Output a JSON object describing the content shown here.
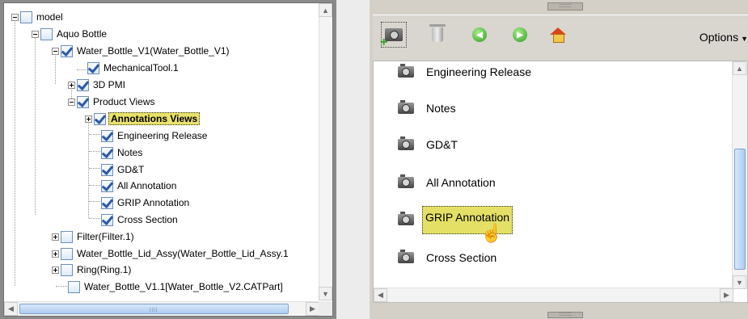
{
  "tree": {
    "nodes": [
      {
        "label": "model"
      },
      {
        "label": "Aquo Bottle"
      },
      {
        "label": "Water_Bottle_V1(Water_Bottle_V1)"
      },
      {
        "label": "MechanicalTool.1"
      },
      {
        "label": "3D PMI"
      },
      {
        "label": "Product Views"
      },
      {
        "label": "Annotations Views"
      },
      {
        "label": "Engineering Release"
      },
      {
        "label": "Notes"
      },
      {
        "label": "GD&T"
      },
      {
        "label": "All Annotation"
      },
      {
        "label": "GRIP Annotation"
      },
      {
        "label": "Cross Section"
      },
      {
        "label": "Filter(Filter.1)"
      },
      {
        "label": "Water_Bottle_Lid_Assy(Water_Bottle_Lid_Assy.1"
      },
      {
        "label": "Ring(Ring.1)"
      },
      {
        "label": "Water_Bottle_V1.1[Water_Bottle_V2.CATPart]"
      }
    ],
    "selected": "Annotations Views",
    "scroll_grip": "||||"
  },
  "toolbar": {
    "icons": [
      "add-view-camera-icon",
      "trash-icon",
      "back-arrow-icon",
      "forward-arrow-icon",
      "home-icon"
    ],
    "options_label": "Options",
    "grip_text": "::::::::"
  },
  "views": {
    "items": [
      {
        "label": "Engineering Release"
      },
      {
        "label": "Notes"
      },
      {
        "label": "GD&T"
      },
      {
        "label": "All Annotation"
      },
      {
        "label": "GRIP Annotation"
      },
      {
        "label": "Cross Section"
      }
    ],
    "selected": "GRIP Annotation",
    "highlight_color": "#e4e065"
  }
}
